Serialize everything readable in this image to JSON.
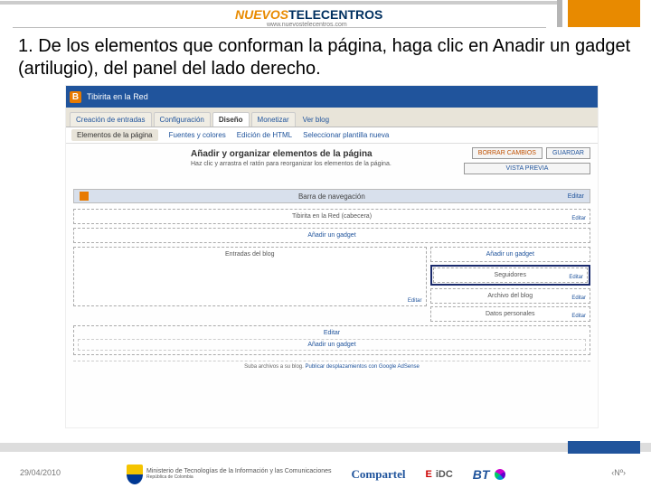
{
  "brand": {
    "part1": "NUEVOS",
    "part2": "TELECENTROS",
    "url": "www.nuevostelecentros.com"
  },
  "title": "1. De los elementos que conforman la página, haga clic en Anadir un gadget (artilugio), del panel del lado derecho.",
  "blogger": {
    "blog_title": "Tibirita en la Red",
    "tabs": {
      "t1": "Creación de entradas",
      "t2": "Configuración",
      "t3": "Diseño",
      "t4": "Monetizar",
      "link": "Ver blog"
    },
    "subtabs": {
      "s1": "Elementos de la página",
      "s2": "Fuentes y colores",
      "s3": "Edición de HTML",
      "s4": "Seleccionar plantilla nueva"
    },
    "panel": {
      "heading": "Añadir y organizar elementos de la página",
      "sub": "Haz clic y arrastra el ratón para reorganizar los elementos de la página.",
      "btn_discard": "BORRAR CAMBIOS",
      "btn_save": "GUARDAR",
      "btn_preview": "VISTA PREVIA",
      "navbar": "Barra de navegación",
      "edit": "Editar",
      "header_box": "Tibirita en la Red (cabecera)",
      "add_gadget": "Añadir un gadget",
      "entries": "Entradas del blog",
      "seguidores": "Seguidores",
      "archivo": "Archivo del blog",
      "datos": "Datos personales",
      "footer_link": "Editar",
      "fine": "Suba archivos a su blog.",
      "fine_link": "Publicar desplazamientos con Google AdSense"
    }
  },
  "footer": {
    "date": "29/04/2010",
    "num": "‹Nº›",
    "ministerio": "Ministerio de Tecnologías de la Información y las Comunicaciones",
    "republica": "República de Colombia",
    "compartel": "Compartel",
    "eidc": "EiDC",
    "bt": "BT"
  }
}
